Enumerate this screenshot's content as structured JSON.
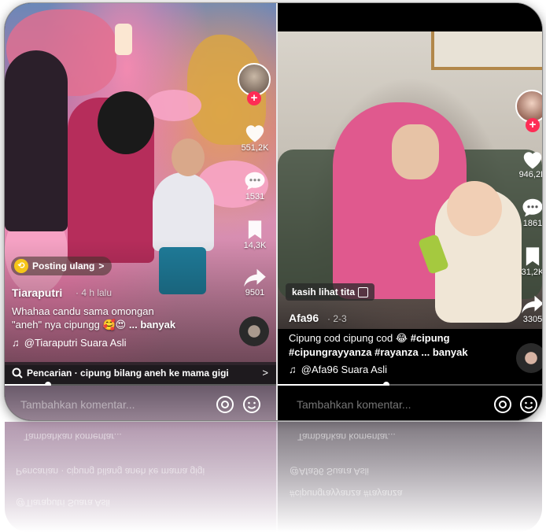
{
  "left": {
    "likes": "551,2K",
    "comments": "1531",
    "saves": "14,3K",
    "shares": "9501",
    "repost_label": "Posting ulang",
    "repost_chevron": ">",
    "username": "Tiaraputri",
    "time": "· 4 h lalu",
    "caption_line1": "Whahaa candu sama omongan",
    "caption_line2_pre": "\"aneh\" nya cipungg",
    "caption_emojis": "🥰😍",
    "caption_more": "... banyak",
    "sound": "@Tiaraputri Suara Asli",
    "search_text": "Pencarian · cipung bilang aneh ke mama gigi",
    "search_chevron": ">",
    "comment_placeholder": "Tambahkan komentar...",
    "progress": 0.16
  },
  "right": {
    "likes": "946,2K",
    "comments": "1861",
    "saves": "31,2K",
    "shares": "3305",
    "sticker": "kasih lihat tita",
    "username": "Afa96",
    "time": "· 2-3",
    "caption_line1_pre": "Cipung cod cipung cod",
    "caption_emoji": "😂",
    "caption_tag1": "#cipung",
    "caption_line2_tags": "#cipungrayyanza #rayanza",
    "caption_more": "... banyak",
    "sound": "@Afa96 Suara Asli",
    "comment_placeholder": "Tambahkan komentar...",
    "progress": 0.41
  },
  "colors": {
    "accent_red": "#fe2c55",
    "search_bar_bg": "#2b2b2b"
  },
  "icons": [
    "heart-icon",
    "comment-icon",
    "bookmark-icon",
    "share-icon",
    "music-note-icon",
    "search-icon",
    "at-icon",
    "emoji-icon",
    "repost-icon"
  ]
}
